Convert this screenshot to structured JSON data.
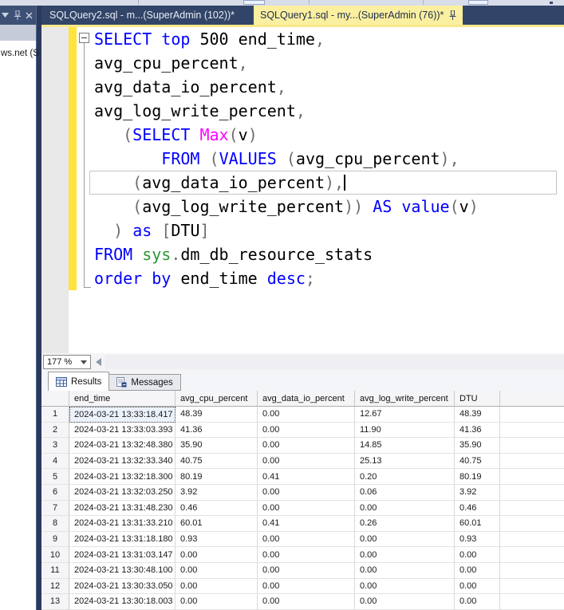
{
  "tabs": {
    "inactive": {
      "label": "SQLQuery2.sql - m...(SuperAdmin (102))*"
    },
    "active": {
      "label": "SQLQuery1.sql - my...(SuperAdmin (76))*"
    }
  },
  "side_panel": {
    "server_text": "ws.net (S"
  },
  "editor": {
    "zoom_value": "177 %",
    "cursor_line_index": 6,
    "syntax_colors": {
      "keyword": "#0000FF",
      "function": "#FF00FF",
      "schema": "#2C9633",
      "punctuation": "#6E6E6E",
      "text": "#000000"
    },
    "lines": [
      [
        [
          "SELECT top ",
          "k"
        ],
        [
          "500 end_time",
          "t"
        ],
        [
          ",",
          "p"
        ]
      ],
      [
        [
          "avg_cpu_percent",
          "t"
        ],
        [
          ",",
          "p"
        ]
      ],
      [
        [
          "avg_data_io_percent",
          "t"
        ],
        [
          ",",
          "p"
        ]
      ],
      [
        [
          "avg_log_write_percent",
          "t"
        ],
        [
          ",",
          "p"
        ]
      ],
      [
        [
          "   ",
          "t"
        ],
        [
          "(",
          "p"
        ],
        [
          "SELECT",
          "k"
        ],
        [
          " ",
          "t"
        ],
        [
          "Max",
          "f"
        ],
        [
          "(",
          "p"
        ],
        [
          "v",
          "t"
        ],
        [
          ")",
          "p"
        ]
      ],
      [
        [
          "       ",
          "t"
        ],
        [
          "FROM",
          "k"
        ],
        [
          " ",
          "t"
        ],
        [
          "(",
          "p"
        ],
        [
          "VALUES",
          "k"
        ],
        [
          " ",
          "t"
        ],
        [
          "(",
          "p"
        ],
        [
          "avg_cpu_percent",
          "t"
        ],
        [
          "),",
          "p"
        ]
      ],
      [
        [
          "    ",
          "t"
        ],
        [
          "(",
          "p"
        ],
        [
          "avg_data_io_percent",
          "t"
        ],
        [
          "),",
          "p"
        ]
      ],
      [
        [
          "    ",
          "t"
        ],
        [
          "(",
          "p"
        ],
        [
          "avg_log_write_percent",
          "t"
        ],
        [
          "))",
          "p"
        ],
        [
          " ",
          "t"
        ],
        [
          "AS",
          "k"
        ],
        [
          " ",
          "t"
        ],
        [
          "value",
          "k"
        ],
        [
          "(",
          "p"
        ],
        [
          "v",
          "t"
        ],
        [
          ")",
          "p"
        ]
      ],
      [
        [
          "  ",
          "t"
        ],
        [
          ")",
          "p"
        ],
        [
          " ",
          "t"
        ],
        [
          "as",
          "k"
        ],
        [
          " ",
          "t"
        ],
        [
          "[",
          "p"
        ],
        [
          "DTU",
          "t"
        ],
        [
          "]",
          "p"
        ]
      ],
      [
        [
          "FROM",
          "k"
        ],
        [
          " ",
          "t"
        ],
        [
          "sys",
          "s"
        ],
        [
          ".",
          "p"
        ],
        [
          "dm_db_resource_stats",
          "t"
        ]
      ],
      [
        [
          "order by",
          "k"
        ],
        [
          " end_time ",
          "t"
        ],
        [
          "desc",
          "k"
        ],
        [
          ";",
          "p"
        ]
      ]
    ]
  },
  "results": {
    "tabs": [
      {
        "label": "Results"
      },
      {
        "label": "Messages"
      }
    ],
    "grid": {
      "columns": [
        "",
        "end_time",
        "avg_cpu_percent",
        "avg_data_io_percent",
        "avg_log_write_percent",
        "DTU"
      ],
      "selected_cell": {
        "row": 1,
        "column": "end_time"
      },
      "rows": [
        [
          "1",
          "2024-03-21 13:33:18.417",
          "48.39",
          "0.00",
          "12.67",
          "48.39"
        ],
        [
          "2",
          "2024-03-21 13:33:03.393",
          "41.36",
          "0.00",
          "11.90",
          "41.36"
        ],
        [
          "3",
          "2024-03-21 13:32:48.380",
          "35.90",
          "0.00",
          "14.85",
          "35.90"
        ],
        [
          "4",
          "2024-03-21 13:32:33.340",
          "40.75",
          "0.00",
          "25.13",
          "40.75"
        ],
        [
          "5",
          "2024-03-21 13:32:18.300",
          "80.19",
          "0.41",
          "0.20",
          "80.19"
        ],
        [
          "6",
          "2024-03-21 13:32:03.250",
          "3.92",
          "0.00",
          "0.06",
          "3.92"
        ],
        [
          "7",
          "2024-03-21 13:31:48.230",
          "0.46",
          "0.00",
          "0.00",
          "0.46"
        ],
        [
          "8",
          "2024-03-21 13:31:33.210",
          "60.01",
          "0.41",
          "0.26",
          "60.01"
        ],
        [
          "9",
          "2024-03-21 13:31:18.180",
          "0.93",
          "0.00",
          "0.00",
          "0.93"
        ],
        [
          "10",
          "2024-03-21 13:31:03.147",
          "0.00",
          "0.00",
          "0.00",
          "0.00"
        ],
        [
          "11",
          "2024-03-21 13:30:48.100",
          "0.00",
          "0.00",
          "0.00",
          "0.00"
        ],
        [
          "12",
          "2024-03-21 13:30:33.050",
          "0.00",
          "0.00",
          "0.00",
          "0.00"
        ],
        [
          "13",
          "2024-03-21 13:30:18.003",
          "0.00",
          "0.00",
          "0.00",
          "0.00"
        ]
      ]
    }
  },
  "colors": {
    "tab_bar": "#324568",
    "active_tab": "#FBEFA0",
    "change_tracking": "#FFE43C",
    "divider": "#2A3A5C"
  }
}
